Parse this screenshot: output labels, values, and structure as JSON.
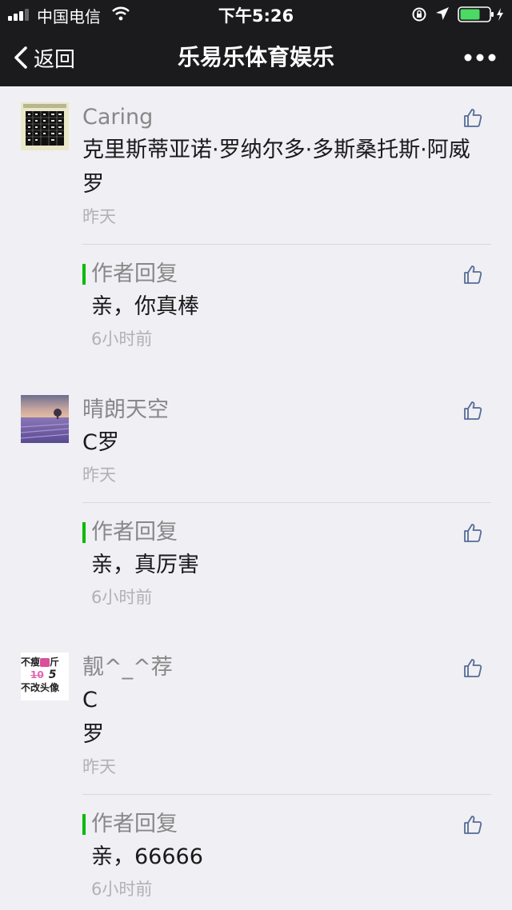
{
  "status_bar": {
    "carrier": "中国电信",
    "time": "下午5:26",
    "icons": [
      "signal-icon",
      "wifi-icon",
      "orientation-lock-icon",
      "location-icon",
      "battery-icon"
    ]
  },
  "nav": {
    "back_label": "返回",
    "title": "乐易乐体育娱乐",
    "more_icon": "more-icon"
  },
  "comments": [
    {
      "nickname": "Caring",
      "text": "克里斯蒂亚诺·罗纳尔多·多斯桑托斯·阿威罗",
      "date": "昨天",
      "avatar_icon": "number-grid-avatar",
      "reply": {
        "label": "作者回复",
        "text": "亲，你真棒",
        "time": "6小时前"
      }
    },
    {
      "nickname": "晴朗天空",
      "text": "C罗",
      "date": "昨天",
      "avatar_icon": "lavender-field-avatar",
      "reply": {
        "label": "作者回复",
        "text": "亲，真厉害",
        "time": "6小时前"
      }
    },
    {
      "nickname": "靓^_^荐",
      "text": "C",
      "text2": "罗",
      "date": "昨天",
      "avatar_icon": "text-avatar",
      "avatar_text": {
        "line1a": "不瘦",
        "line1b": "斤",
        "line2a": "10",
        "line2b": "5",
        "line3": "不改头像"
      },
      "reply": {
        "label": "作者回复",
        "text": "亲，66666",
        "time": "6小时前"
      }
    }
  ],
  "colors": {
    "nav_bg": "#1b1b1d",
    "page_bg": "#efeff4",
    "reply_accent": "#09bb07",
    "battery_fill": "#4cd964",
    "secondary_text": "#888888",
    "time_text": "#b2b2b2"
  }
}
